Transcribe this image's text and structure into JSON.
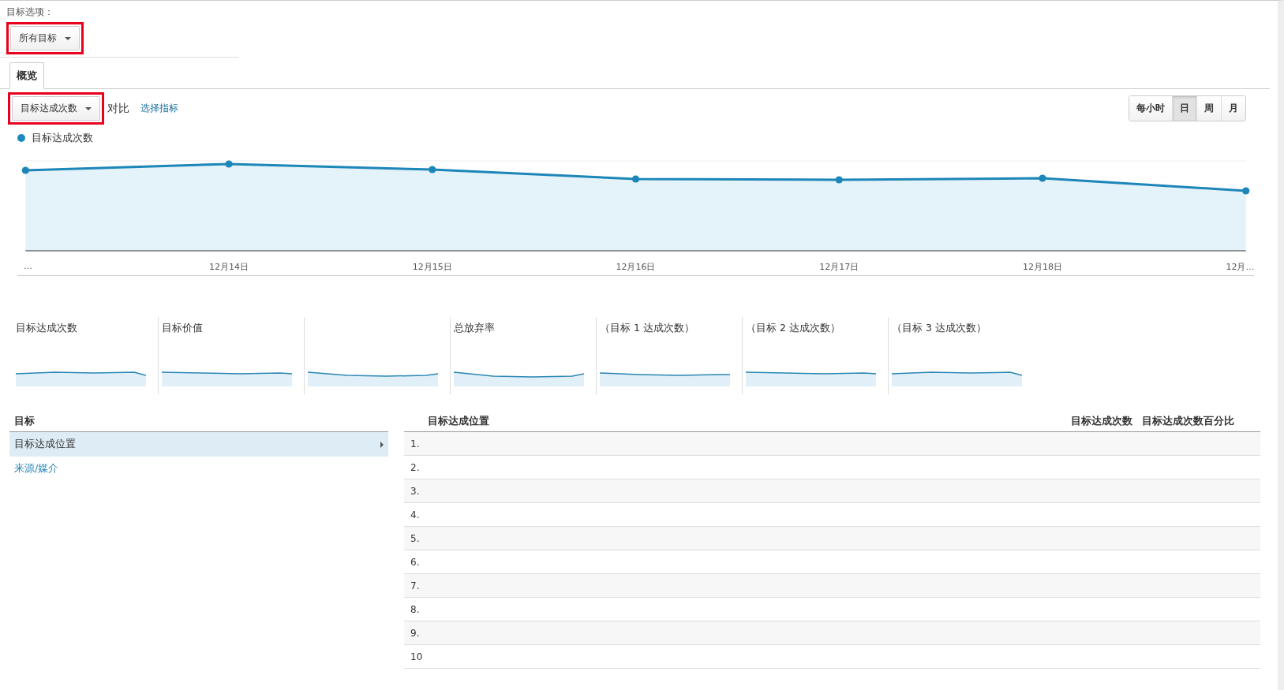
{
  "goal_options": {
    "label": "目标选项：",
    "dropdown": {
      "value": "所有目标",
      "highlighted": true
    }
  },
  "tabs": [
    {
      "label": "概览",
      "selected": true
    }
  ],
  "metric_bar": {
    "dropdown": {
      "value": "目标达成次数",
      "highlighted": true
    },
    "versus": "对比",
    "select_metric": "选择指标"
  },
  "granularity": [
    {
      "label": "每小时",
      "selected": false
    },
    {
      "label": "日",
      "selected": true
    },
    {
      "label": "周",
      "selected": false
    },
    {
      "label": "月",
      "selected": false
    }
  ],
  "chart": {
    "legend": "目标达成次数",
    "x_labels": [
      "…",
      "12月14日",
      "12月15日",
      "12月16日",
      "12月17日",
      "12月18日",
      "12月…"
    ]
  },
  "scorecards": [
    {
      "kind": "metric",
      "label": "目标达成次数"
    },
    {
      "kind": "metric",
      "label": "目标价值"
    },
    {
      "kind": "covered"
    },
    {
      "kind": "metric",
      "label": "总放弃率"
    },
    {
      "kind": "metric",
      "label": "（目标 1 达成次数）"
    },
    {
      "kind": "metric",
      "label": "（目标 2 达成次数）"
    },
    {
      "kind": "metric",
      "label": "（目标 3 达成次数）"
    }
  ],
  "goals_panel": {
    "heading": "目标",
    "items": [
      {
        "label": "目标达成位置",
        "selected": true
      },
      {
        "label": "来源/媒介",
        "selected": false
      }
    ]
  },
  "table": {
    "columns": [
      "目标达成位置",
      "目标达成次数",
      "目标达成次数百分比"
    ],
    "rows": [
      {
        "index": "1."
      },
      {
        "index": "2."
      },
      {
        "index": "3."
      },
      {
        "index": "4."
      },
      {
        "index": "5."
      },
      {
        "index": "6."
      },
      {
        "index": "7."
      },
      {
        "index": "8."
      },
      {
        "index": "9."
      },
      {
        "index": "10"
      }
    ]
  }
}
